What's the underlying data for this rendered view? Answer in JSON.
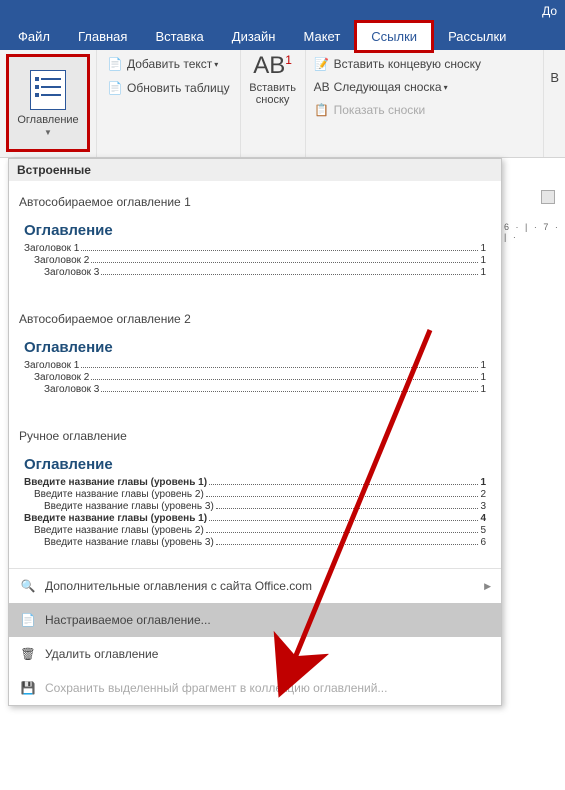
{
  "title_bar": {
    "text": "До"
  },
  "menu": {
    "file": "Файл",
    "home": "Главная",
    "insert": "Вставка",
    "design": "Дизайн",
    "layout": "Макет",
    "references": "Ссылки",
    "mailings": "Рассылки"
  },
  "ribbon": {
    "toc": {
      "label": "Оглавление"
    },
    "add_text": "Добавить текст",
    "update_table": "Обновить таблицу",
    "insert_footnote": {
      "big": "AB",
      "sup": "1",
      "label": "Вставить сноску"
    },
    "insert_endnote": "Вставить концевую сноску",
    "next_footnote": "Следующая сноска",
    "show_notes": "Показать сноски",
    "right_letter": "В"
  },
  "dropdown": {
    "header": "Встроенные",
    "auto1": {
      "title": "Автособираемое оглавление 1",
      "preview_title": "Оглавление",
      "lines": [
        {
          "text": "Заголовок 1",
          "page": "1",
          "indent": 0
        },
        {
          "text": "Заголовок 2",
          "page": "1",
          "indent": 1
        },
        {
          "text": "Заголовок 3",
          "page": "1",
          "indent": 2
        }
      ]
    },
    "auto2": {
      "title": "Автособираемое оглавление 2",
      "preview_title": "Оглавление",
      "lines": [
        {
          "text": "Заголовок 1",
          "page": "1",
          "indent": 0
        },
        {
          "text": "Заголовок 2",
          "page": "1",
          "indent": 1
        },
        {
          "text": "Заголовок 3",
          "page": "1",
          "indent": 2
        }
      ]
    },
    "manual": {
      "title": "Ручное оглавление",
      "preview_title": "Оглавление",
      "lines": [
        {
          "text": "Введите название главы (уровень 1)",
          "page": "1",
          "indent": 0,
          "bold": true
        },
        {
          "text": "Введите название главы (уровень 2)",
          "page": "2",
          "indent": 1
        },
        {
          "text": "Введите название главы (уровень 3)",
          "page": "3",
          "indent": 2
        },
        {
          "text": "Введите название главы (уровень 1)",
          "page": "4",
          "indent": 0,
          "bold": true
        },
        {
          "text": "Введите название главы (уровень 2)",
          "page": "5",
          "indent": 1
        },
        {
          "text": "Введите название главы (уровень 3)",
          "page": "6",
          "indent": 2
        }
      ]
    },
    "footer": {
      "more": "Дополнительные оглавления с сайта Office.com",
      "custom": "Настраиваемое оглавление...",
      "remove": "Удалить оглавление",
      "save": "Сохранить выделенный фрагмент в коллекцию оглавлений..."
    }
  },
  "ruler": {
    "marks": "6 · | · 7 · | ·"
  },
  "colors": {
    "accent": "#2b579a",
    "highlight": "#c00000"
  }
}
